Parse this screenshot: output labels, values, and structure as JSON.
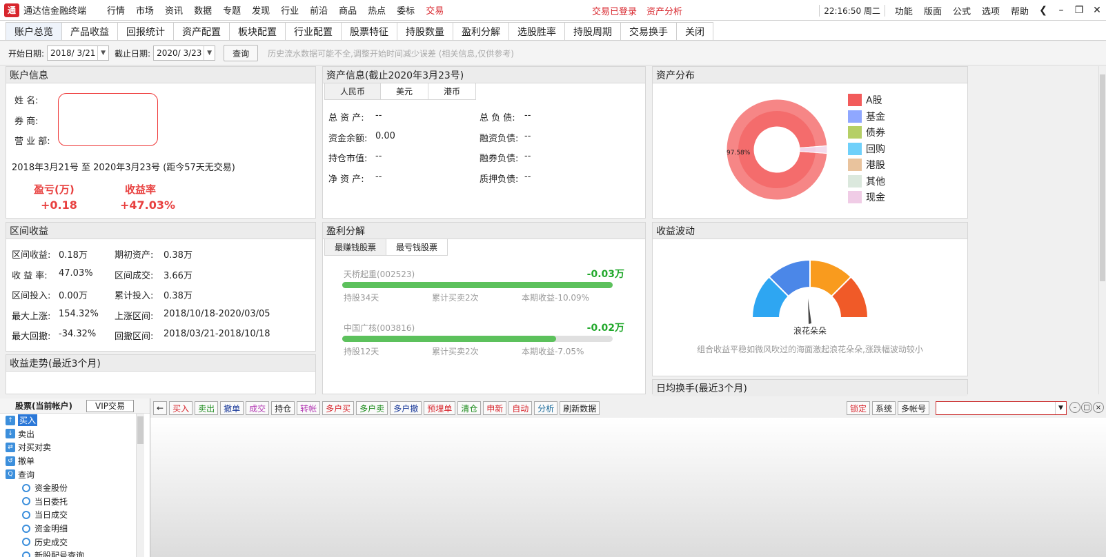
{
  "menubar": {
    "logo_text": "通",
    "app_title": "通达信金融终端",
    "items": [
      "行情",
      "市场",
      "资讯",
      "数据",
      "专题",
      "发现",
      "行业",
      "前沿",
      "商品",
      "热点",
      "委标",
      "交易"
    ],
    "active_index": 11,
    "center_items": [
      "交易已登录",
      "资产分析"
    ],
    "clock": "22:16:50 周二",
    "right_items": [
      "功能",
      "版面",
      "公式",
      "选项",
      "帮助"
    ],
    "window_buttons": [
      "❮",
      "–",
      "❐",
      "✕"
    ]
  },
  "subtabs": [
    "账户总览",
    "产品收益",
    "回报统计",
    "资产配置",
    "板块配置",
    "行业配置",
    "股票特征",
    "持股数量",
    "盈利分解",
    "选股胜率",
    "持股周期",
    "交易换手",
    "关闭"
  ],
  "datebar": {
    "start_label": "开始日期:",
    "start_value": "2018/ 3/21",
    "end_label": "截止日期:",
    "end_value": "2020/ 3/23",
    "query_button": "查询",
    "note": "历史流水数据可能不全,调整开始时间减少误差 (相关信息,仅供参考)"
  },
  "account": {
    "header": "账户信息",
    "name_label": "姓    名:",
    "broker_label": "券    商:",
    "branch_label": "营 业 部:",
    "period": "2018年3月21号 至 2020年3月23号  (距今57天无交易)",
    "pnl_label": "盈亏(万)",
    "pnl_value": "+0.18",
    "ret_label": "收益率",
    "ret_value": "+47.03%"
  },
  "asset_info": {
    "header": "资产信息(截止2020年3月23号)",
    "currency_tabs": [
      "人民币",
      "美元",
      "港币"
    ],
    "rows": [
      {
        "l1": "总 资 产:",
        "v1": "--",
        "l2": "总 负 债:",
        "v2": "--"
      },
      {
        "l1": "资金余额:",
        "v1": "0.00",
        "l2": "融资负债:",
        "v2": "--"
      },
      {
        "l1": "持仓市值:",
        "v1": "--",
        "l2": "融券负债:",
        "v2": "--"
      },
      {
        "l1": "净 资 产:",
        "v1": "--",
        "l2": "质押负债:",
        "v2": "--"
      }
    ]
  },
  "asset_dist": {
    "header": "资产分布",
    "pie_label": "97.58%",
    "legend": [
      {
        "name": "A股",
        "color": "#f25b5b"
      },
      {
        "name": "基金",
        "color": "#8fa7ff"
      },
      {
        "name": "债券",
        "color": "#b5cf66"
      },
      {
        "name": "回购",
        "color": "#6fd0fa"
      },
      {
        "name": "港股",
        "color": "#e9c39d"
      },
      {
        "name": "其他",
        "color": "#dbe8dd"
      },
      {
        "name": "现金",
        "color": "#f0cce6"
      }
    ],
    "slices": [
      {
        "name": "A股",
        "value": 97.58,
        "color": "#f46c6c"
      },
      {
        "name": "现金",
        "value": 2.42,
        "color": "#f2d3e8"
      }
    ]
  },
  "interval": {
    "header": "区间收益",
    "rows": [
      {
        "l1": "区间收益:",
        "v1": "0.18万",
        "l2": "期初资产:",
        "v2": "0.38万"
      },
      {
        "l1": "收 益 率:",
        "v1": "47.03%",
        "l2": "区间成交:",
        "v2": "3.66万"
      },
      {
        "l1": "区间投入:",
        "v1": "0.00万",
        "l2": "累计投入:",
        "v2": "0.38万"
      },
      {
        "l1": "最大上涨:",
        "v1": "154.32%",
        "l2": "上涨区间:",
        "v2": "2018/10/18-2020/03/05"
      },
      {
        "l1": "最大回撤:",
        "v1": "-34.32%",
        "l2": "回撤区间:",
        "v2": "2018/03/21-2018/10/18"
      }
    ]
  },
  "trend": {
    "header": "收益走势(最近3个月)"
  },
  "profit_breakdown": {
    "header": "盈利分解",
    "tabs": [
      "最赚钱股票",
      "最亏钱股票"
    ],
    "stocks": [
      {
        "name": "天桥起重(002523)",
        "value": "-0.03万",
        "hold": "持股34天",
        "trades": "累计买卖2次",
        "period": "本期收益-10.09%",
        "fill": 1.0
      },
      {
        "name": "中国广核(003816)",
        "value": "-0.02万",
        "hold": "持股12天",
        "trades": "累计买卖2次",
        "period": "本期收益-7.05%",
        "fill": 0.79
      }
    ]
  },
  "volatility": {
    "header": "收益波动",
    "gauge_label": "浪花朵朵",
    "description": "组合收益平稳如微风吹过的海面激起浪花朵朵,涨跌幅波动较小",
    "gauge_colors": [
      "#2ea6f2",
      "#4b87e8",
      "#f99b1e",
      "#f05a28"
    ]
  },
  "turnover": {
    "header": "日均换手(最近3个月)"
  },
  "left_nav": {
    "header": "股票(当前帐户)",
    "vip_button": "VIP交易",
    "items": [
      "买入",
      "卖出",
      "对买对卖",
      "撤单",
      "查询"
    ],
    "sub_items": [
      "资金股份",
      "当日委托",
      "当日成交",
      "资金明细",
      "历史成交",
      "新股配号查询"
    ]
  },
  "trade_toolbar": {
    "buttons": [
      {
        "label": "←",
        "color": "#222"
      },
      {
        "label": "买入",
        "color": "#d8262d"
      },
      {
        "label": "卖出",
        "color": "#1a8a1a"
      },
      {
        "label": "撤单",
        "color": "#1a3a9a"
      },
      {
        "label": "成交",
        "color": "#b43cb4"
      },
      {
        "label": "持仓",
        "color": "#222"
      },
      {
        "label": "转帐",
        "color": "#b43cb4"
      },
      {
        "label": "多户买",
        "color": "#d8262d"
      },
      {
        "label": "多户卖",
        "color": "#1a8a1a"
      },
      {
        "label": "多户撤",
        "color": "#1a3a9a"
      },
      {
        "label": "预埋单",
        "color": "#d8262d"
      },
      {
        "label": "清仓",
        "color": "#1a8a1a"
      },
      {
        "label": "申新",
        "color": "#d8262d"
      },
      {
        "label": "自动",
        "color": "#d8262d"
      },
      {
        "label": "分析",
        "color": "#1a6a9a"
      },
      {
        "label": "刷新数据",
        "color": "#222"
      }
    ],
    "right_buttons": [
      {
        "label": "锁定",
        "color": "#d8262d"
      },
      {
        "label": "系统",
        "color": "#222"
      },
      {
        "label": "多帐号",
        "color": "#222"
      }
    ]
  }
}
